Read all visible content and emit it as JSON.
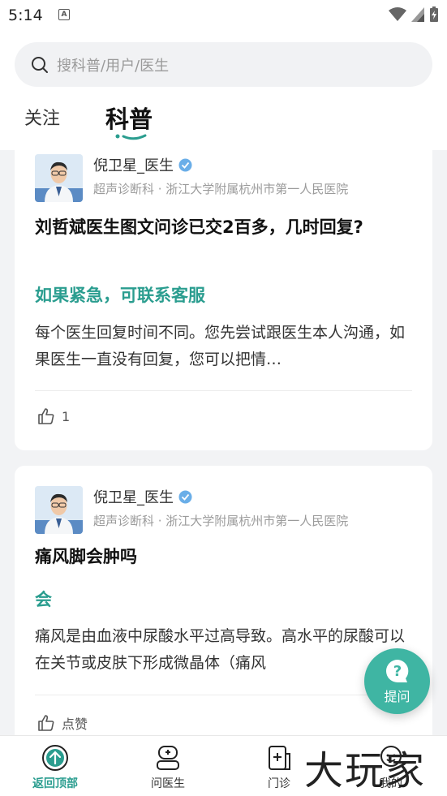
{
  "status_bar": {
    "time": "5:14",
    "notification_icon": "A"
  },
  "search": {
    "placeholder": "搜科普/用户/医生"
  },
  "tabs": [
    {
      "label": "关注",
      "active": false
    },
    {
      "label": "科普",
      "active": true
    }
  ],
  "feed": [
    {
      "author_name": "倪卫星_医生",
      "author_dept": "超声诊断科 · 浙江大学附属杭州市第一人民医院",
      "question": "刘哲斌医生图文问诊已交2百多，几时回复?",
      "answer_headline": "如果紧急，可联系客服",
      "answer_body": "每个医生回复时间不同。您先尝试跟医生本人沟通，如果医生一直没有回复，您可以把情…",
      "like_count": "1"
    },
    {
      "author_name": "倪卫星_医生",
      "author_dept": "超声诊断科 · 浙江大学附属杭州市第一人民医院",
      "question": "痛风脚会肿吗",
      "answer_headline": "会",
      "answer_body": "痛风是由血液中尿酸水平过高导致。高水平的尿酸可以在关节或皮肤下形成微晶体（痛风",
      "like_label": "点赞"
    }
  ],
  "fab": {
    "label": "提问"
  },
  "bottom_nav": [
    {
      "label": "返回顶部",
      "active": true
    },
    {
      "label": "问医生",
      "active": false
    },
    {
      "label": "门诊",
      "active": false
    },
    {
      "label": "我的",
      "active": false
    }
  ],
  "watermark": "大玩家",
  "colors": {
    "accent": "#2a9d8f",
    "fab": "#3fb5a3",
    "verified": "#6aaee8"
  }
}
